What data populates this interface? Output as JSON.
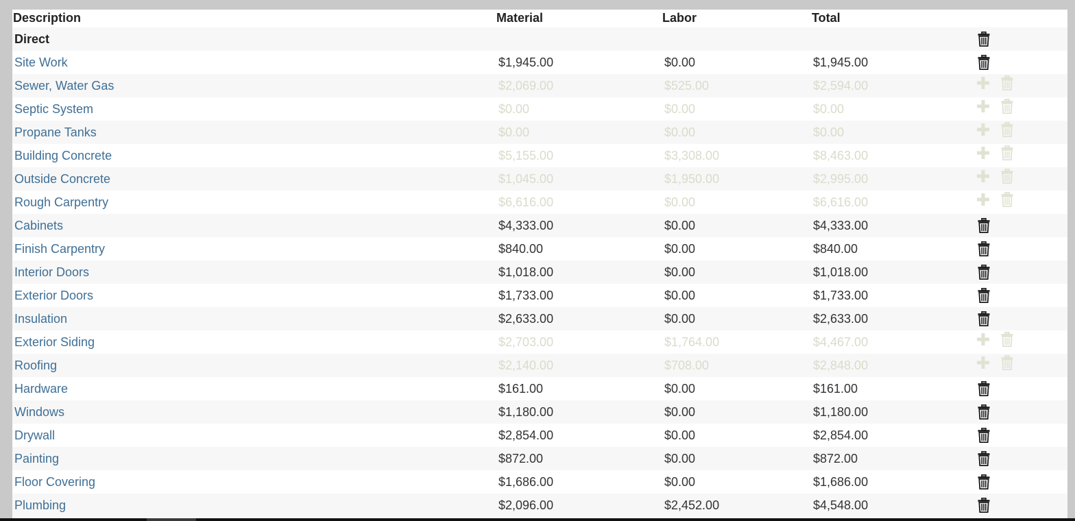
{
  "table": {
    "headers": {
      "description": "Description",
      "material": "Material",
      "labor": "Labor",
      "total": "Total"
    },
    "group_label": "Direct",
    "rows": [
      {
        "description": "Site Work",
        "material": "$1,945.00",
        "labor": "$0.00",
        "total": "$1,945.00",
        "enabled": true
      },
      {
        "description": "Sewer, Water Gas",
        "material": "$2,069.00",
        "labor": "$525.00",
        "total": "$2,594.00",
        "enabled": false
      },
      {
        "description": "Septic System",
        "material": "$0.00",
        "labor": "$0.00",
        "total": "$0.00",
        "enabled": false
      },
      {
        "description": "Propane Tanks",
        "material": "$0.00",
        "labor": "$0.00",
        "total": "$0.00",
        "enabled": false
      },
      {
        "description": "Building Concrete",
        "material": "$5,155.00",
        "labor": "$3,308.00",
        "total": "$8,463.00",
        "enabled": false
      },
      {
        "description": "Outside Concrete",
        "material": "$1,045.00",
        "labor": "$1,950.00",
        "total": "$2,995.00",
        "enabled": false
      },
      {
        "description": "Rough Carpentry",
        "material": "$6,616.00",
        "labor": "$0.00",
        "total": "$6,616.00",
        "enabled": false
      },
      {
        "description": "Cabinets",
        "material": "$4,333.00",
        "labor": "$0.00",
        "total": "$4,333.00",
        "enabled": true
      },
      {
        "description": "Finish Carpentry",
        "material": "$840.00",
        "labor": "$0.00",
        "total": "$840.00",
        "enabled": true
      },
      {
        "description": "Interior Doors",
        "material": "$1,018.00",
        "labor": "$0.00",
        "total": "$1,018.00",
        "enabled": true
      },
      {
        "description": "Exterior Doors",
        "material": "$1,733.00",
        "labor": "$0.00",
        "total": "$1,733.00",
        "enabled": true
      },
      {
        "description": "Insulation",
        "material": "$2,633.00",
        "labor": "$0.00",
        "total": "$2,633.00",
        "enabled": true
      },
      {
        "description": "Exterior Siding",
        "material": "$2,703.00",
        "labor": "$1,764.00",
        "total": "$4,467.00",
        "enabled": false
      },
      {
        "description": "Roofing",
        "material": "$2,140.00",
        "labor": "$708.00",
        "total": "$2,848.00",
        "enabled": false
      },
      {
        "description": "Hardware",
        "material": "$161.00",
        "labor": "$0.00",
        "total": "$161.00",
        "enabled": true
      },
      {
        "description": "Windows",
        "material": "$1,180.00",
        "labor": "$0.00",
        "total": "$1,180.00",
        "enabled": true
      },
      {
        "description": "Drywall",
        "material": "$2,854.00",
        "labor": "$0.00",
        "total": "$2,854.00",
        "enabled": true
      },
      {
        "description": "Painting",
        "material": "$872.00",
        "labor": "$0.00",
        "total": "$872.00",
        "enabled": true
      },
      {
        "description": "Floor Covering",
        "material": "$1,686.00",
        "labor": "$0.00",
        "total": "$1,686.00",
        "enabled": true
      },
      {
        "description": "Plumbing",
        "material": "$2,096.00",
        "labor": "$2,452.00",
        "total": "$4,548.00",
        "enabled": true
      }
    ]
  },
  "icons": {
    "delete": "trash-icon",
    "add": "plus-icon"
  },
  "colors": {
    "link": "#3f6f96",
    "disabled_text": "#d8dccb",
    "disabled_icon": "#dfe3d2",
    "row_alt": "#f7f7f7",
    "frame": "#c9c9c9"
  }
}
